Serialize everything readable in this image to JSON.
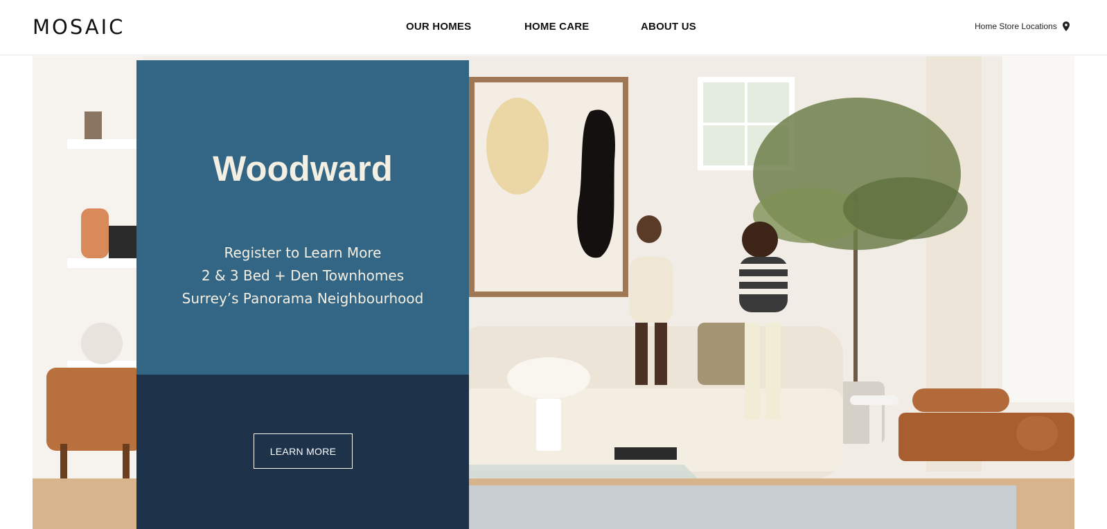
{
  "header": {
    "logo": "MOSAIC",
    "nav": [
      {
        "label": "OUR HOMES"
      },
      {
        "label": "HOME CARE"
      },
      {
        "label": "ABOUT US"
      }
    ],
    "store_locations": "Home Store Locations",
    "store_icon": "map-pin-icon"
  },
  "hero": {
    "title": "Woodward",
    "lines": [
      "Register to Learn More",
      "2 & 3 Bed + Den Townhomes",
      "Surrey’s Panorama Neighbourhood"
    ],
    "cta_label": "LEARN MORE",
    "colors": {
      "panel_top": "#336685",
      "panel_bottom": "#1e3349",
      "text": "#f4efe3"
    }
  }
}
